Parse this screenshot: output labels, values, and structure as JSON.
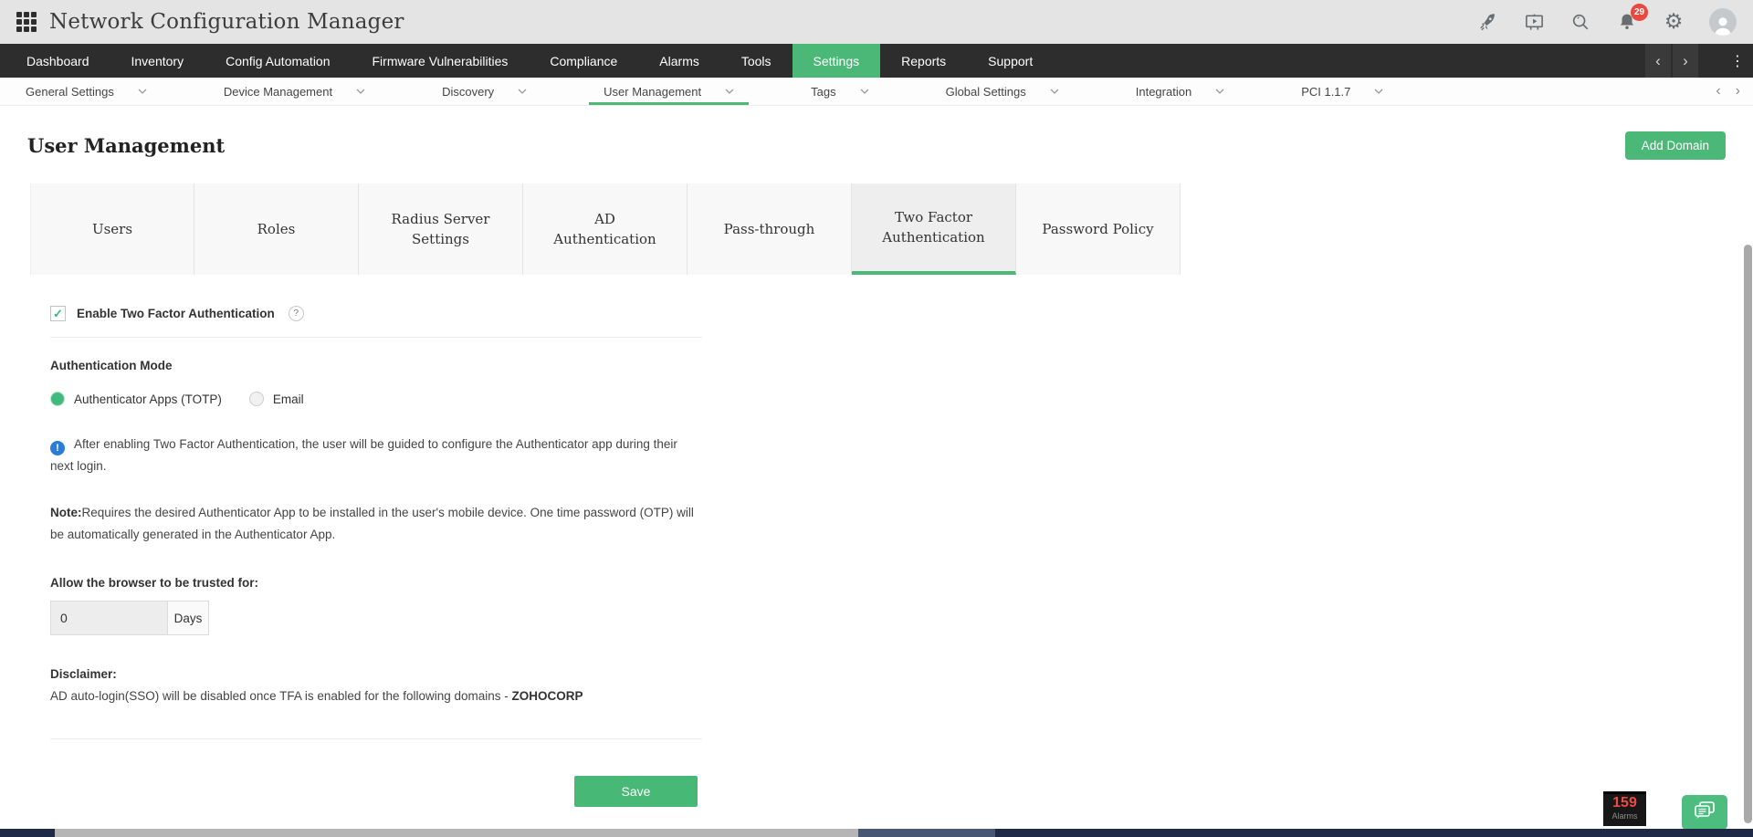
{
  "app": {
    "title": "Network Configuration Manager"
  },
  "topbar": {
    "notification_count": "29",
    "icons": [
      "apps-grid-icon",
      "rocket-icon",
      "presentation-icon",
      "search-icon",
      "bell-icon",
      "gear-icon",
      "avatar"
    ],
    "gear_glyph": "⚙"
  },
  "nav": {
    "items": [
      {
        "label": "Dashboard",
        "active": false
      },
      {
        "label": "Inventory",
        "active": false
      },
      {
        "label": "Config Automation",
        "active": false
      },
      {
        "label": "Firmware Vulnerabilities",
        "active": false
      },
      {
        "label": "Compliance",
        "active": false
      },
      {
        "label": "Alarms",
        "active": false
      },
      {
        "label": "Tools",
        "active": false
      },
      {
        "label": "Settings",
        "active": true
      },
      {
        "label": "Reports",
        "active": false
      },
      {
        "label": "Support",
        "active": false
      }
    ],
    "chevron_left": "‹",
    "chevron_right": "›",
    "more_vertical": "⋮"
  },
  "subnav": {
    "items": [
      {
        "label": "General Settings",
        "active": false
      },
      {
        "label": "Device Management",
        "active": false
      },
      {
        "label": "Discovery",
        "active": false
      },
      {
        "label": "User Management",
        "active": true
      },
      {
        "label": "Tags",
        "active": false
      },
      {
        "label": "Global Settings",
        "active": false
      },
      {
        "label": "Integration",
        "active": false
      },
      {
        "label": "PCI 1.1.7",
        "active": false
      }
    ],
    "chevron_left": "‹",
    "chevron_right": "›"
  },
  "page": {
    "title": "User Management",
    "add_domain_label": "Add Domain"
  },
  "tabs": [
    {
      "label": "Users",
      "active": false
    },
    {
      "label": "Roles",
      "active": false
    },
    {
      "label": "Radius Server Settings",
      "active": false
    },
    {
      "label": "AD Authentication",
      "active": false
    },
    {
      "label": "Pass-through",
      "active": false
    },
    {
      "label": "Two Factor Authentication",
      "active": true
    },
    {
      "label": "Password Policy",
      "active": false
    }
  ],
  "content": {
    "enable_label": "Enable Two Factor Authentication",
    "enable_checked_glyph": "✓",
    "help_glyph": "?",
    "auth_mode_label": "Authentication Mode",
    "radio_options": [
      {
        "label": "Authenticator Apps (TOTP)",
        "selected": true
      },
      {
        "label": "Email",
        "selected": false
      }
    ],
    "info_glyph": "!",
    "info_text": "After enabling Two Factor Authentication, the user will be guided to configure the Authenticator app during their next login.",
    "note_label": "Note:",
    "note_text": "Requires the desired Authenticator App to be installed in the user's mobile device. One time password (OTP) will be automatically generated in the Authenticator App.",
    "trust_label": "Allow the browser to be trusted for:",
    "trust_value": "0",
    "trust_unit": "Days",
    "disclaimer_label": "Disclaimer:",
    "disclaimer_text": "AD auto-login(SSO) will be disabled once TFA is enabled for the following domains - ",
    "disclaimer_domain": "ZOHOCORP",
    "save_label": "Save"
  },
  "footer": {
    "alarms_count": "159",
    "alarms_label": "Alarms"
  },
  "colors": {
    "accent_green": "#4cb878",
    "info_blue": "#2a7cd5",
    "alarm_red": "#ef4a45",
    "navbar_bg": "#2d2d2d",
    "topbar_bg": "#e4e4e4"
  }
}
